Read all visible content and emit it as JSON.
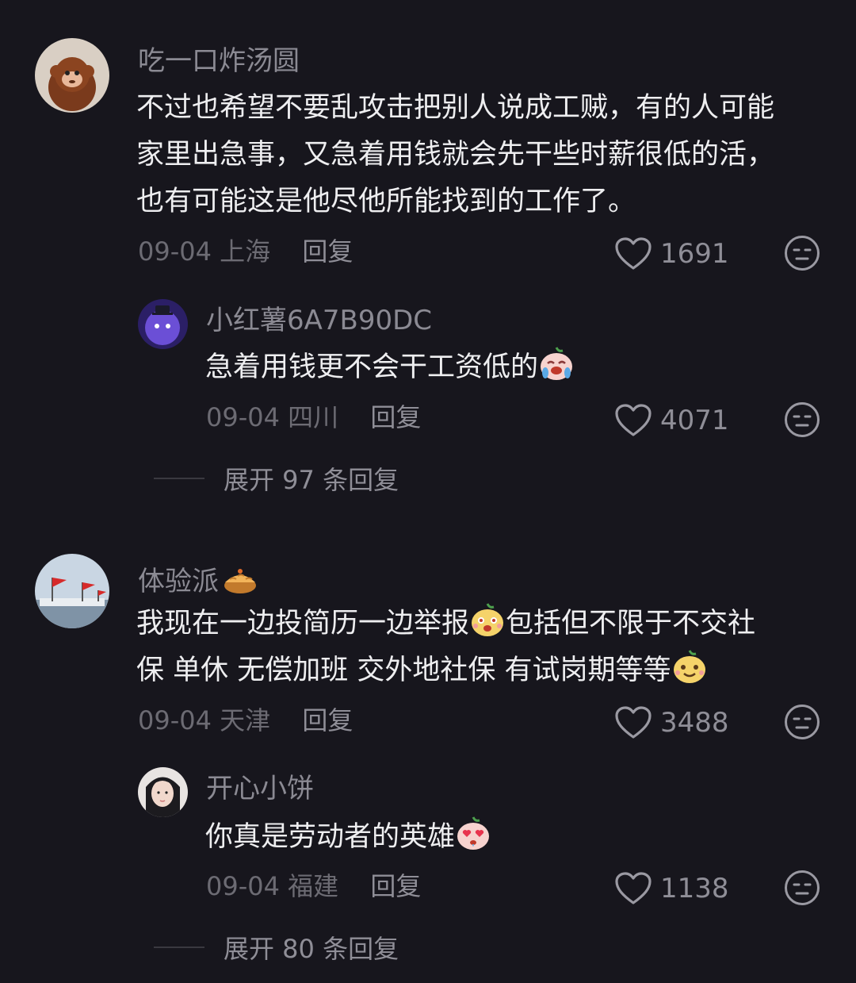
{
  "comments": [
    {
      "user": "吃一口炸汤圆",
      "lines": [
        "不过也希望不要乱攻击把别人说成工贼，有的人可能",
        "家里出急事，又急着用钱就会先干些时薪很低的活，",
        "也有可能这是他尽他所能找到的工作了。"
      ],
      "date": "09-04",
      "location": "上海",
      "reply_label": "回复",
      "likes": "1691",
      "avatar_icon": "monkey-costume-avatar",
      "replies": [
        {
          "user": "小红薯6A7B90DC",
          "text": "急着用钱更不会干工资低的",
          "emoji": "crying-face-emoji",
          "date": "09-04",
          "location": "四川",
          "reply_label": "回复",
          "likes": "4071"
        }
      ],
      "expand_label": "展开 97 条回复"
    },
    {
      "user": "体验派",
      "user_emoji": "pie-emoji",
      "lines": [
        "我现在一边投简历一边举报",
        "包括但不限于不交社",
        "保 单休 无偿加班 交外地社保 有试岗期等等"
      ],
      "date": "09-04",
      "location": "天津",
      "reply_label": "回复",
      "likes": "3488",
      "avatar_icon": "flags-photo-avatar",
      "replies": [
        {
          "user": "开心小饼",
          "text": "你真是劳动者的英雄",
          "emoji": "heart-eyes-emoji",
          "date": "09-04",
          "location": "福建",
          "reply_label": "回复",
          "likes": "1138"
        }
      ],
      "expand_label": "展开 80 条回复"
    }
  ],
  "colors": {
    "background": "#17161d",
    "primary_text": "#eeeef0",
    "secondary_text": "#8b8a93",
    "meta_text": "#6c6b73"
  }
}
